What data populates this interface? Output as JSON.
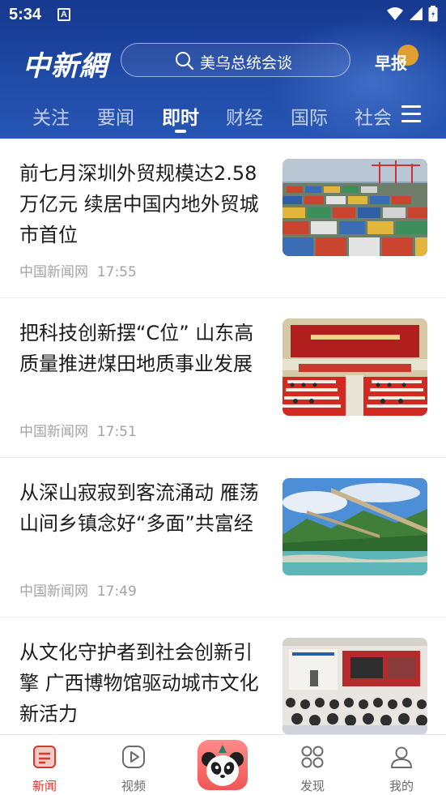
{
  "status_bar": {
    "time": "5:34",
    "notification_icon": "A"
  },
  "header": {
    "logo_text": "中新網",
    "search_placeholder": "美乌总统会谈",
    "zaobao_label": "早报"
  },
  "tabs": [
    {
      "label": "关注",
      "active": false
    },
    {
      "label": "要闻",
      "active": false
    },
    {
      "label": "即时",
      "active": true
    },
    {
      "label": "财经",
      "active": false
    },
    {
      "label": "国际",
      "active": false
    },
    {
      "label": "社会",
      "active": false
    }
  ],
  "feed": [
    {
      "title": "前七月深圳外贸规模达2.58万亿元 续居中国内地外贸城市首位",
      "source": "中国新闻网",
      "time": "17:55",
      "image": "container-port-photo"
    },
    {
      "title": "把科技创新摆“C位” 山东高质量推进煤田地质事业发展",
      "source": "中国新闻网",
      "time": "17:51",
      "image": "conference-hall-photo"
    },
    {
      "title": "从深山寂寂到客流涌动 雁荡山间乡镇念好“多面”共富经",
      "source": "中国新闻网",
      "time": "17:49",
      "image": "mountain-river-photo"
    },
    {
      "title": "从文化守护者到社会创新引擎 广西博物馆驱动城市文化新活力",
      "source": "",
      "time": "",
      "image": "museum-forum-photo"
    }
  ],
  "bottom_nav": [
    {
      "label": "新闻",
      "icon": "news-icon",
      "active": true
    },
    {
      "label": "视频",
      "icon": "video-play-icon",
      "active": false
    },
    {
      "label": "",
      "icon": "panda-mascot-icon",
      "active": false
    },
    {
      "label": "发现",
      "icon": "discover-grid-icon",
      "active": false
    },
    {
      "label": "我的",
      "icon": "profile-icon",
      "active": false
    }
  ],
  "colors": {
    "header": "#1f4aa6",
    "accent": "#d53a30",
    "zaobao_badge": "#f5a623"
  }
}
